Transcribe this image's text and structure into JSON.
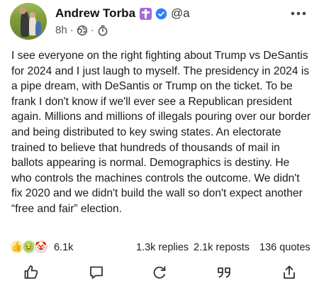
{
  "header": {
    "name": "Andrew Torba",
    "handle": "@a",
    "time": "8h",
    "separator": "·",
    "badge_color": "#a56cd6",
    "verified_color": "#2f7ef5"
  },
  "post": {
    "text": "I see everyone on the right fighting about Trump vs DeSantis for 2024 and I just laugh to myself. The presidency in 2024 is a pipe dream, with DeSantis or Trump on the ticket. To be frank I don't know if we'll ever see a Republican president again. Millions and millions of illegals pouring over our border and being distributed to key swing states. An electorate trained to believe that hundreds of thousands of mail in ballots appearing is normal. Demographics is destiny. He who controls the machines controls the outcome. We didn't fix 2020 and we didn't build the wall so don't expect another “free and fair” election."
  },
  "stats": {
    "reactions_count": "6.1k",
    "replies": "1.3k replies",
    "reposts": "2.1k reposts",
    "quotes": "136 quotes"
  },
  "reactions": [
    "👍",
    "🤢",
    "🤡"
  ],
  "actions": [
    "like-icon",
    "comment-icon",
    "repost-icon",
    "quote-icon",
    "share-icon"
  ]
}
